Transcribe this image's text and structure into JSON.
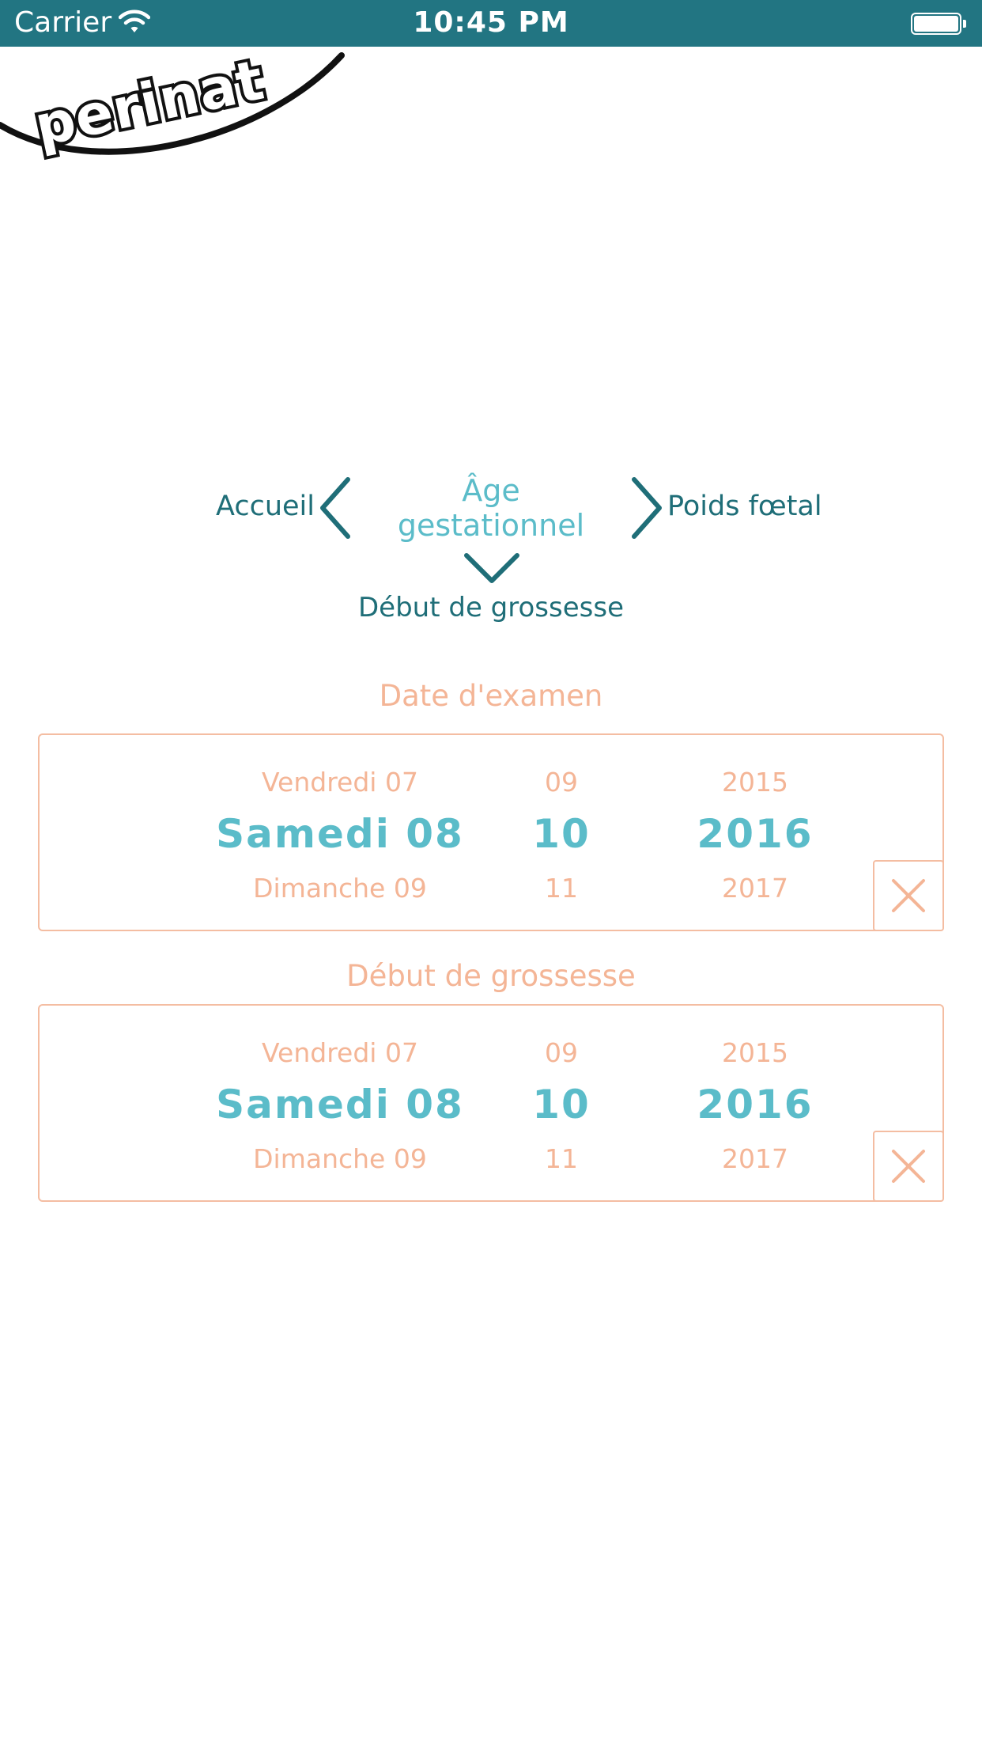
{
  "status_bar": {
    "carrier": "Carrier",
    "time": "10:45 PM",
    "wifi_icon": "wifi-icon",
    "battery_icon": "battery-icon"
  },
  "app": {
    "logo_text": "perinat",
    "logo_icon": "perinat-logo"
  },
  "navigation": {
    "prev_label": "Accueil",
    "current_title_line1": "Âge",
    "current_title_line2": "gestationnel",
    "next_label": "Poids fœtal",
    "sub_label": "Début de grossesse",
    "prev_icon": "chevron-left-icon",
    "next_icon": "chevron-right-icon",
    "down_icon": "chevron-down-icon"
  },
  "exam_date": {
    "title": "Date d'examen",
    "day_prev": "Vendredi 07",
    "day_selected": "Samedi 08",
    "day_next": "Dimanche 09",
    "month_prev": "09",
    "month_selected": "10",
    "month_next": "11",
    "year_prev": "2015",
    "year_selected": "2016",
    "year_next": "2017",
    "clear_icon": "close-icon"
  },
  "pregnancy_start": {
    "title": "Début de grossesse",
    "day_prev": "Vendredi 07",
    "day_selected": "Samedi 08",
    "day_next": "Dimanche 09",
    "month_prev": "09",
    "month_selected": "10",
    "month_next": "11",
    "year_prev": "2015",
    "year_selected": "2016",
    "year_next": "2017",
    "clear_icon": "close-icon"
  },
  "colors": {
    "status_bar": "#227582",
    "nav_text": "#1f6e78",
    "accent_teal": "#5bbcc9",
    "accent_peach": "#f4b596"
  }
}
